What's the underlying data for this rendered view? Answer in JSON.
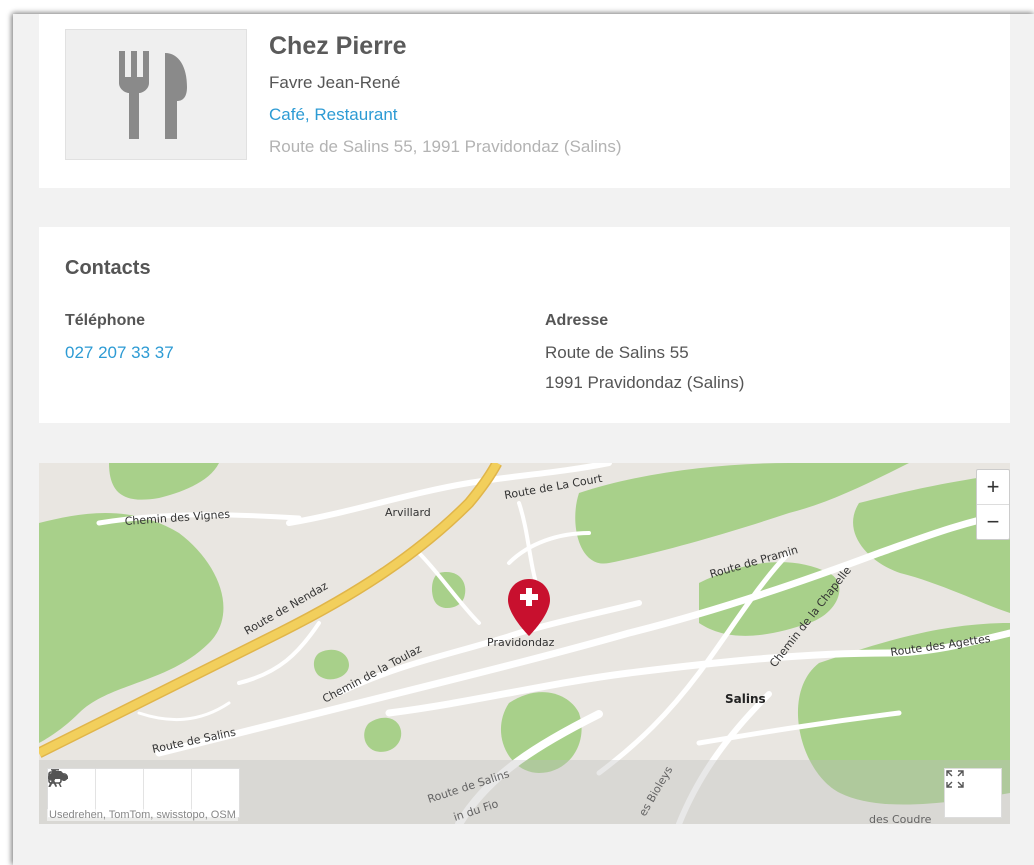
{
  "header": {
    "title": "Chez Pierre",
    "owner": "Favre Jean-René",
    "category": "Café, Restaurant",
    "address": "Route de Salins 55, 1991 Pravidondaz (Salins)",
    "logo_icon": "fork-knife-icon"
  },
  "contacts": {
    "section_title": "Contacts",
    "phone_label": "Téléphone",
    "phone": "027 207 33 37",
    "address_label": "Adresse",
    "address_line1": "Route de Salins 55",
    "address_line2": "1991 Pravidondaz (Salins)"
  },
  "map": {
    "labels": {
      "chemin_vignes": "Chemin des Vignes",
      "arvillard": "Arvillard",
      "route_courte": "Route de La Court",
      "route_nendaz": "Route de Nendaz",
      "route_pramin": "Route de Pramin",
      "chemin_chapelle": "Chemin de la Chapelle",
      "chemin_toulaz": "Chemin de la Toulaz",
      "pravidondaz": "Pravidondaz",
      "route_agettes": "Route des Agettes",
      "salins": "Salins",
      "route_salins": "Route de Salins",
      "route_salins2": "Route de Salins",
      "fio": "in du Fio",
      "bioleys": "es Bioleys",
      "coudre": "des Coudre"
    },
    "zoom_in": "+",
    "zoom_out": "−",
    "attribution": "Usedrehen, TomTom, swisstopo, OSM",
    "transport_modes": [
      "car-icon",
      "train-icon",
      "bike-icon",
      "walk-icon"
    ],
    "colors": {
      "forest": "#a8d08a",
      "land": "#e9e6e1",
      "highway": "#f2cf5c",
      "road": "#ffffff",
      "marker": "#c8102e"
    }
  }
}
